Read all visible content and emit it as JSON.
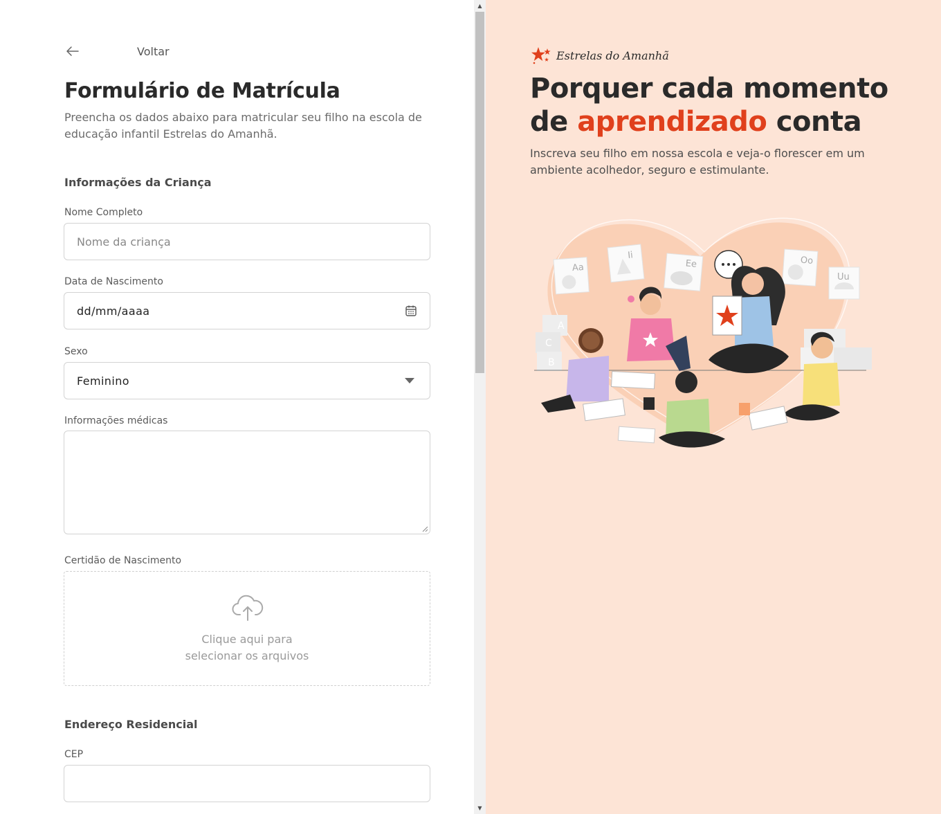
{
  "back": {
    "label": "Voltar"
  },
  "form": {
    "title": "Formulário de Matrícula",
    "subtitle": "Preencha os dados abaixo para matricular seu filho na escola de educação infantil Estrelas do Amanhã.",
    "child_section": "Informações da Criança",
    "name": {
      "label": "Nome Completo",
      "placeholder": "Nome da criança"
    },
    "birth": {
      "label": "Data de Nascimento",
      "value": "dd/mm/aaaa"
    },
    "sex": {
      "label": "Sexo",
      "value": "Feminino"
    },
    "medical": {
      "label": "Informações médicas"
    },
    "certificate": {
      "label": "Certidão de Nascimento",
      "line1": "Clique aqui para",
      "line2": "selecionar os arquivos"
    },
    "address_section": "Endereço Residencial",
    "cep": {
      "label": "CEP"
    }
  },
  "brand": {
    "name": "Estrelas do Amanhã",
    "color": "#e0401c"
  },
  "hero": {
    "line1": "Porquer cada momento",
    "line2_pre": "de ",
    "line2_accent": "aprendizado",
    "line2_post": " conta",
    "description": "Inscreva seu filho em nossa escola e veja-o florescer em um ambiente acolhedor, seguro e estimulante.",
    "accent_color": "#e0401c",
    "background": "#fde4d6"
  },
  "illustration": {
    "cards": [
      "Aa",
      "Ii",
      "Ee",
      "Oo",
      "Uu"
    ],
    "blocks": [
      "A",
      "C",
      "B"
    ]
  }
}
